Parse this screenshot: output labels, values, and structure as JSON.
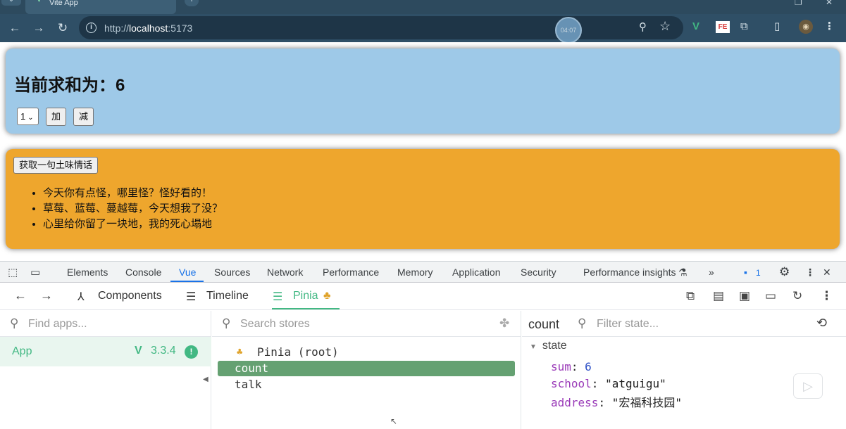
{
  "browser": {
    "tab_title": "Vite App",
    "url_scheme": "http://",
    "url_host": "localhost",
    "url_port": ":5173",
    "clock_overlay": "04:07"
  },
  "page": {
    "count": {
      "title": "当前求和为：6",
      "select_value": "1",
      "add_label": "加",
      "minus_label": "减"
    },
    "talk": {
      "button_label": "获取一句土味情话",
      "items": [
        "今天你有点怪，哪里怪？怪好看的！",
        "草莓、蓝莓、蔓越莓，今天想我了没？",
        "心里给你留了一块地，我的死心塌地"
      ]
    }
  },
  "devtools": {
    "tabs": [
      "Elements",
      "Console",
      "Vue",
      "Sources",
      "Network",
      "Performance",
      "Memory",
      "Application",
      "Security",
      "Performance insights"
    ],
    "active_tab": "Vue",
    "issues_count": "1",
    "vue_nav": {
      "components": "Components",
      "timeline": "Timeline",
      "pinia": "Pinia"
    },
    "apps_search_placeholder": "Find apps...",
    "app": {
      "name": "App",
      "version": "3.3.4"
    },
    "stores_search_placeholder": "Search stores",
    "stores": [
      {
        "label": "Pinia (root)",
        "selected": false
      },
      {
        "label": "count",
        "selected": true
      },
      {
        "label": "talk",
        "selected": false
      }
    ],
    "state_panel": {
      "store_name": "count",
      "filter_placeholder": "Filter state...",
      "section": "state",
      "props": [
        {
          "key": "sum",
          "value": "6",
          "type": "number"
        },
        {
          "key": "school",
          "value": "\"atguigu\"",
          "type": "string"
        },
        {
          "key": "address",
          "value": "\"宏福科技园\"",
          "type": "string"
        }
      ]
    }
  }
}
